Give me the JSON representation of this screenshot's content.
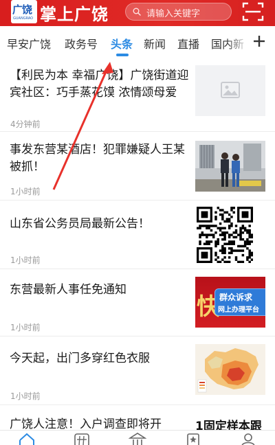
{
  "header": {
    "logo_text": "广饶",
    "logo_sub": "GUANGRAO",
    "title": "掌上广饶",
    "search_placeholder": "请输入关键字",
    "brand_color": "#e02a26"
  },
  "tabs": [
    {
      "label": "早安广饶",
      "active": false
    },
    {
      "label": "政务号",
      "active": false
    },
    {
      "label": "头条",
      "active": true
    },
    {
      "label": "新闻",
      "active": false
    },
    {
      "label": "直播",
      "active": false
    },
    {
      "label": "国内新",
      "active": false
    }
  ],
  "accent_color": "#2c8be3",
  "news": [
    {
      "title": "【利民为本  幸福广饶】广饶街道迎宾社区：巧手蒸花馍  浓情颂母爱",
      "time": "4分钟前",
      "thumb": "placeholder-image-icon"
    },
    {
      "title": "事发东营某酒店！犯罪嫌疑人王某被抓！",
      "time": "1小时前",
      "thumb": "photo-police"
    },
    {
      "title": "山东省公务员局最新公告！",
      "time": "1小时前",
      "thumb": "qr-code"
    },
    {
      "title": "东营最新人事任免通知",
      "time": "1小时前",
      "thumb": "banner",
      "thumb_text_1": "群众诉求",
      "thumb_text_2": "网上办理平台",
      "thumb_char": "快"
    },
    {
      "title": "今天起，出门多穿红色衣服",
      "time": "1小时前",
      "thumb": "map"
    },
    {
      "title": "广饶人注意！入户调查即将开",
      "time": "",
      "thumb": "text-snippet",
      "thumb_text": "1固定样本跟"
    }
  ],
  "bottom_nav": [
    "home-icon",
    "hashtag-icon",
    "government-icon",
    "star-doc-icon",
    "user-icon"
  ]
}
